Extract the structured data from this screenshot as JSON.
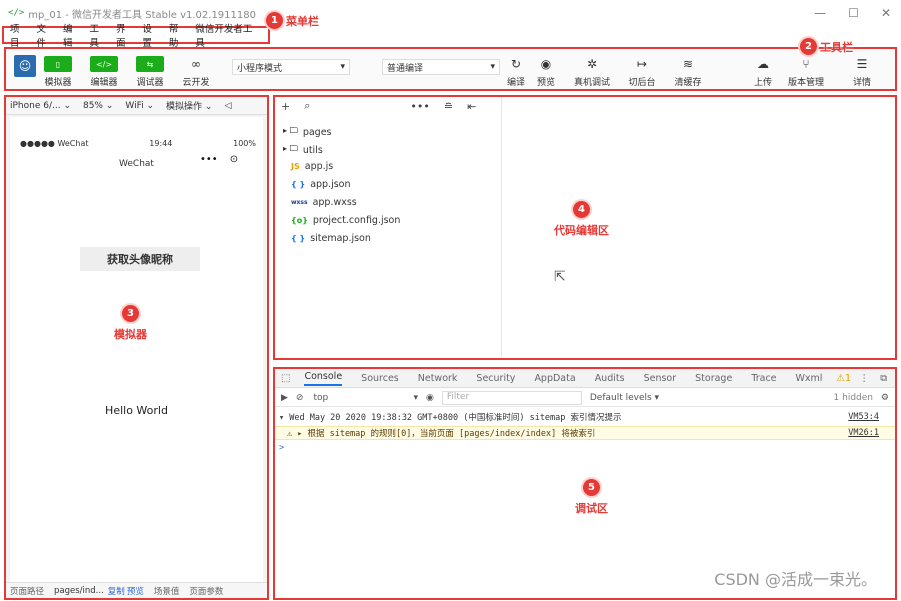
{
  "window": {
    "title": "mp_01 - 微信开发者工具 Stable v1.02.1911180",
    "min": "—",
    "max": "☐",
    "close": "✕"
  },
  "menu": [
    "项目",
    "文件",
    "编辑",
    "工具",
    "界面",
    "设置",
    "帮助",
    "微信开发者工具"
  ],
  "annotations": {
    "a1": {
      "num": "1",
      "label": "菜单栏"
    },
    "a2": {
      "num": "2",
      "label": "工具栏"
    },
    "a3": {
      "num": "3",
      "label": "模拟器"
    },
    "a4": {
      "num": "4",
      "label": "代码编辑区"
    },
    "a5": {
      "num": "5",
      "label": "调试区"
    }
  },
  "toolbar": {
    "simulator": "模拟器",
    "editor": "编辑器",
    "debugger": "调试器",
    "cloud": "云开发",
    "mode": "小程序模式",
    "compile_mode": "普通编译",
    "compile": "编译",
    "preview": "预览",
    "device_debug": "真机调试",
    "background": "切后台",
    "clear_cache": "清缓存",
    "upload": "上传",
    "version": "版本管理",
    "details": "详情"
  },
  "simulator": {
    "device": "iPhone 6/... ⌄",
    "zoom": "85% ⌄",
    "network": "WiFi ⌄",
    "operation": "模拟操作 ⌄",
    "carrier": "●●●●● WeChat",
    "time": "19:44",
    "battery": "100%",
    "nav_title": "WeChat",
    "capsule_dots": "•••",
    "nickname_button": "获取头像昵称",
    "hello": "Hello World",
    "footer": {
      "path_label": "页面路径",
      "path": "pages/ind...",
      "copy": "复制",
      "preview": "预览",
      "scene": "场景值",
      "params": "页面参数"
    }
  },
  "tree": {
    "items": [
      {
        "icon": "▸ 🗀",
        "name": "pages"
      },
      {
        "icon": "▸ 🗀",
        "name": "utils"
      },
      {
        "icon": "JS",
        "name": "app.js"
      },
      {
        "icon": "{ }",
        "name": "app.json"
      },
      {
        "icon": "wxss",
        "name": "app.wxss"
      },
      {
        "icon": "{o}",
        "name": "project.config.json"
      },
      {
        "icon": "{ }",
        "name": "sitemap.json"
      }
    ]
  },
  "debug": {
    "tabs": [
      "Console",
      "Sources",
      "Network",
      "Security",
      "AppData",
      "Audits",
      "Sensor",
      "Storage",
      "Trace",
      "Wxml"
    ],
    "warn_count": "1",
    "context": "top",
    "filter_placeholder": "Filter",
    "levels": "Default levels ▾",
    "hidden": "1 hidden",
    "log1": "▾ Wed May 20 2020 19:38:32 GMT+0800 (中国标准时间) sitemap 索引情况提示",
    "log1_src": "VM53:4",
    "log2": "⚠ ▸ 根据 sitemap 的规则[0]，当前页面 [pages/index/index] 将被索引",
    "log2_src": "VM26:1",
    "prompt": ">"
  },
  "watermark": "CSDN @活成一束光。"
}
